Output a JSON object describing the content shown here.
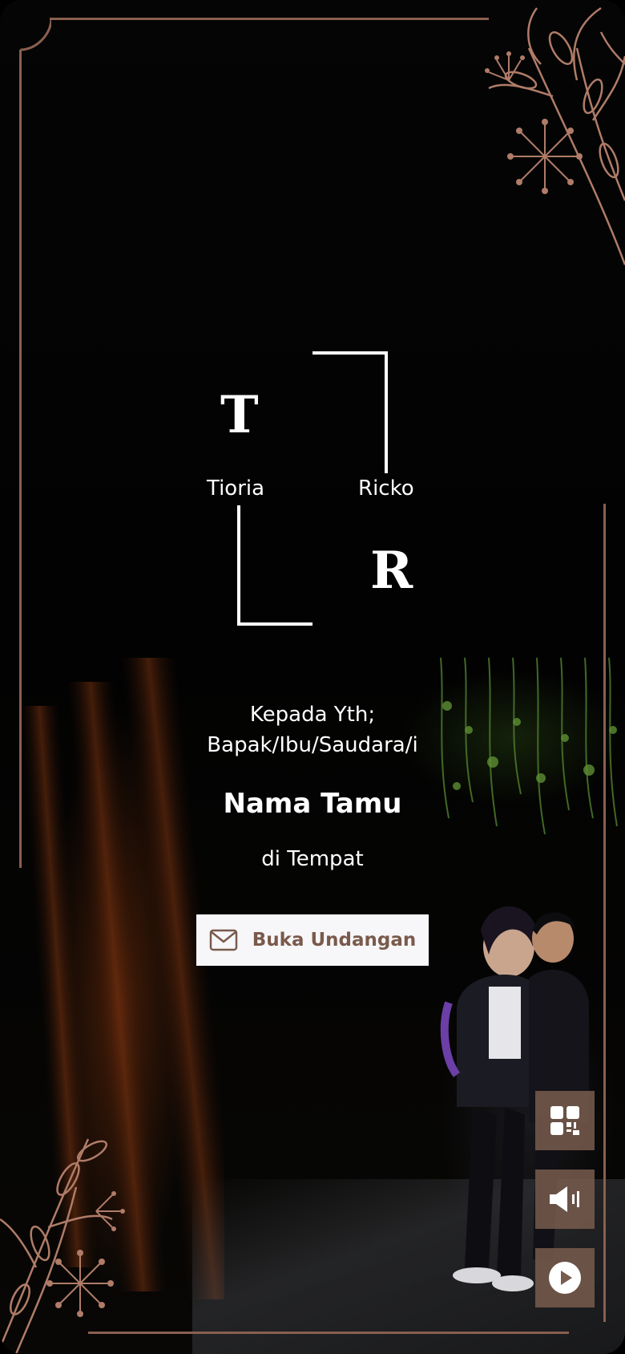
{
  "monogram": {
    "initial_left": "T",
    "initial_right": "R",
    "name_left": "Tioria",
    "name_right": "Ricko"
  },
  "greeting": {
    "line1": "Kepada Yth;",
    "line2": "Bapak/Ibu/Saudara/i",
    "guest_name": "Nama Tamu",
    "place": "di Tempat"
  },
  "open_button": {
    "label": "Buka Undangan",
    "icon": "envelope-icon"
  },
  "side_buttons": [
    {
      "name": "qr-code",
      "icon": "qr-code-icon"
    },
    {
      "name": "sound",
      "icon": "speaker-icon"
    },
    {
      "name": "play",
      "icon": "play-icon"
    }
  ],
  "colors": {
    "accent": "#8a5f4f",
    "button_bg": "#f7f7f9",
    "button_text": "#7a5a4c",
    "side_button_bg": "#785c4e"
  }
}
